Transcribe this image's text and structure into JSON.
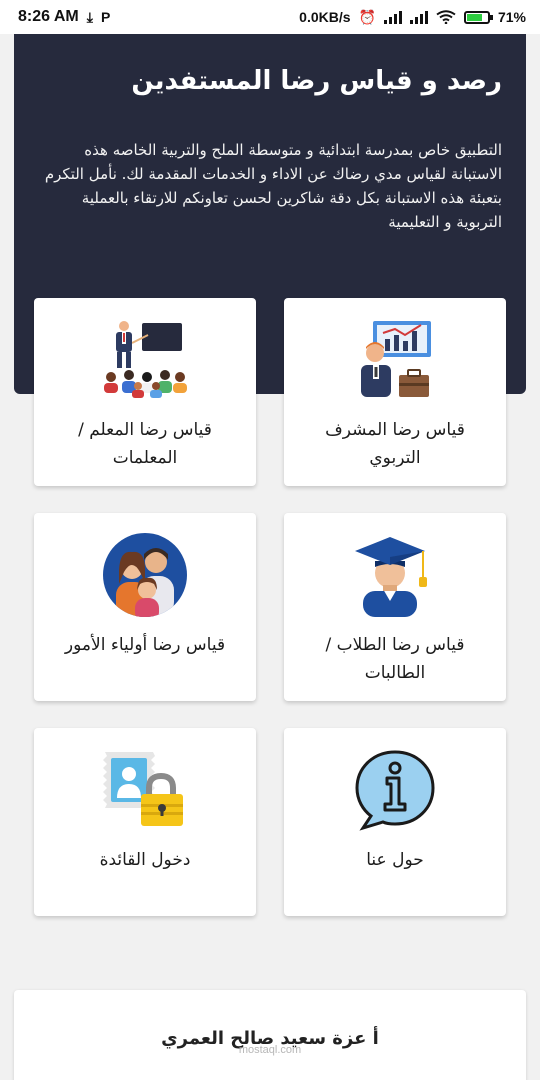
{
  "status_bar": {
    "time": "8:26 AM",
    "left_icons": [
      "download-icon",
      "parking-icon"
    ],
    "net_speed": "0.0KB/s",
    "battery": "71%",
    "right_icons": [
      "alarm-icon",
      "signal-icon",
      "signal-icon",
      "wifi-icon",
      "battery-icon"
    ]
  },
  "header": {
    "title": "رصد و قياس رضا المستفدين",
    "description": "التطبيق خاص بمدرسة ابتدائية و متوسطة الملح والتربية الخاصه هذه الاستبانة لقياس مدي رضاك عن الاداء و الخدمات المقدمة لك. نأمل التكرم بتعبئة هذه الاستبانة بكل دقة شاكرين لحسن تعاونكم للارتقاء بالعملية التربوية و التعليمية"
  },
  "menu": {
    "teacher": {
      "label": "قياس رضا المعلم / المعلمات",
      "icon": "teacher-presentation-icon"
    },
    "supervisor": {
      "label": "قياس رضا المشرف التربوي",
      "icon": "supervisor-chart-icon"
    },
    "parents": {
      "label": "قياس رضا أولياء الأمور",
      "icon": "family-icon"
    },
    "students": {
      "label": "قياس رضا الطلاب /الطالبات",
      "icon": "graduate-cap-icon"
    },
    "leader": {
      "label": "دخول القائدة",
      "icon": "locked-profile-icon"
    },
    "about": {
      "label": "حول عنا",
      "icon": "info-speech-bubble-icon"
    }
  },
  "footer": {
    "name": "أ عزة سعيد صالح العمري",
    "watermark": "mostaql.com"
  },
  "colors": {
    "header_bg": "#262a3d",
    "page_bg": "#f1f1f1",
    "card_bg": "#ffffff"
  }
}
